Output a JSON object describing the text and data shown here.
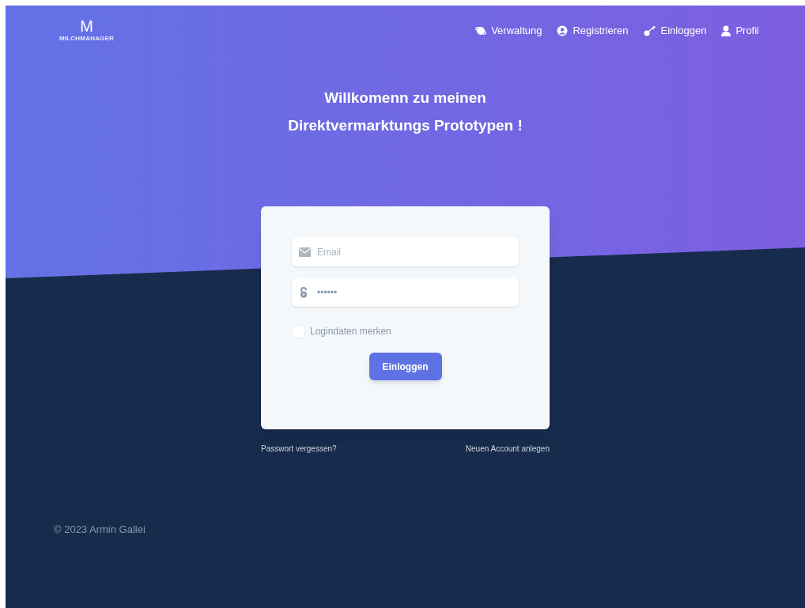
{
  "logo": {
    "mark": "M",
    "name": "MILCHMANAGER"
  },
  "nav": [
    {
      "kind": "admin",
      "label": "Verwaltung"
    },
    {
      "kind": "register",
      "label": "Registrieren"
    },
    {
      "kind": "login",
      "label": "Einloggen"
    },
    {
      "kind": "profile",
      "label": "Profil"
    }
  ],
  "heading": [
    "Willkomenn zu meinen",
    "Direktvermarktungs Prototypen !"
  ],
  "form": {
    "email": {
      "placeholder": "Email"
    },
    "password": {
      "placeholder": "••••••"
    },
    "remember": {
      "label": "Logindaten merken",
      "checked": false
    },
    "submit": "Einloggen"
  },
  "links": [
    "Passwort vergessen?",
    "Neuen Account anlegen"
  ],
  "footer": "© 2023 Armin Gallei"
}
